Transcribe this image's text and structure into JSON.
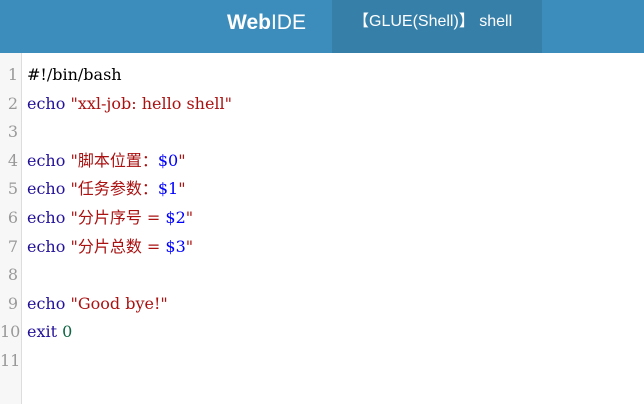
{
  "header": {
    "brand_bold": "Web",
    "brand_rest": "IDE",
    "glue_label": "【GLUE(Shell)】 shell"
  },
  "editor": {
    "lines": [
      {
        "num": "1",
        "parts": [
          {
            "t": "plain",
            "v": "#!/bin/bash"
          }
        ]
      },
      {
        "num": "2",
        "parts": [
          {
            "t": "kw",
            "v": "echo"
          },
          {
            "t": "plain",
            "v": " "
          },
          {
            "t": "str",
            "v": "\"xxl-job: hello shell\""
          }
        ]
      },
      {
        "num": "3",
        "parts": []
      },
      {
        "num": "4",
        "parts": [
          {
            "t": "kw",
            "v": "echo"
          },
          {
            "t": "plain",
            "v": " "
          },
          {
            "t": "str",
            "v": "\"脚本位置："
          },
          {
            "t": "var",
            "v": "$0"
          },
          {
            "t": "str",
            "v": "\""
          }
        ]
      },
      {
        "num": "5",
        "parts": [
          {
            "t": "kw",
            "v": "echo"
          },
          {
            "t": "plain",
            "v": " "
          },
          {
            "t": "str",
            "v": "\"任务参数："
          },
          {
            "t": "var",
            "v": "$1"
          },
          {
            "t": "str",
            "v": "\""
          }
        ]
      },
      {
        "num": "6",
        "parts": [
          {
            "t": "kw",
            "v": "echo"
          },
          {
            "t": "plain",
            "v": " "
          },
          {
            "t": "str",
            "v": "\"分片序号 = "
          },
          {
            "t": "var",
            "v": "$2"
          },
          {
            "t": "str",
            "v": "\""
          }
        ]
      },
      {
        "num": "7",
        "parts": [
          {
            "t": "kw",
            "v": "echo"
          },
          {
            "t": "plain",
            "v": " "
          },
          {
            "t": "str",
            "v": "\"分片总数 = "
          },
          {
            "t": "var",
            "v": "$3"
          },
          {
            "t": "str",
            "v": "\""
          }
        ]
      },
      {
        "num": "8",
        "parts": []
      },
      {
        "num": "9",
        "parts": [
          {
            "t": "kw",
            "v": "echo"
          },
          {
            "t": "plain",
            "v": " "
          },
          {
            "t": "str",
            "v": "\"Good bye!\""
          }
        ]
      },
      {
        "num": "10",
        "parts": [
          {
            "t": "kw",
            "v": "exit"
          },
          {
            "t": "plain",
            "v": " "
          },
          {
            "t": "num",
            "v": "0"
          }
        ]
      },
      {
        "num": "11",
        "parts": []
      }
    ]
  }
}
